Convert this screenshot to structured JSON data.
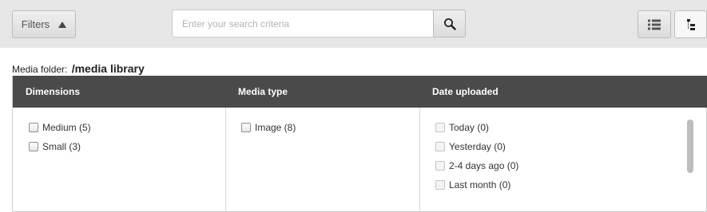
{
  "toolbar": {
    "filters_label": "Filters",
    "search_placeholder": "Enter your search criteria",
    "search_value": ""
  },
  "media_folder": {
    "label": "Media folder:",
    "path": "/media library"
  },
  "columns": [
    {
      "title": "Dimensions",
      "options": [
        {
          "label": "Medium (5)",
          "checked": false
        },
        {
          "label": "Small (3)",
          "checked": false
        }
      ]
    },
    {
      "title": "Media type",
      "options": [
        {
          "label": "Image (8)",
          "checked": false
        }
      ]
    },
    {
      "title": "Date uploaded",
      "options": [
        {
          "label": "Today (0)",
          "checked": false,
          "disabled": true
        },
        {
          "label": "Yesterday (0)",
          "checked": false,
          "disabled": true
        },
        {
          "label": "2-4 days ago (0)",
          "checked": false,
          "disabled": true
        },
        {
          "label": "Last month (0)",
          "checked": false,
          "disabled": true
        }
      ]
    }
  ],
  "icons": {
    "filters_toggle": "caret-up-icon",
    "search": "magnifier-icon",
    "list_view": "list-view-icon",
    "tree_view": "tree-view-icon"
  },
  "colors": {
    "toolbar_bg": "#e6e6e6",
    "header_bg": "#4a4a4a"
  }
}
